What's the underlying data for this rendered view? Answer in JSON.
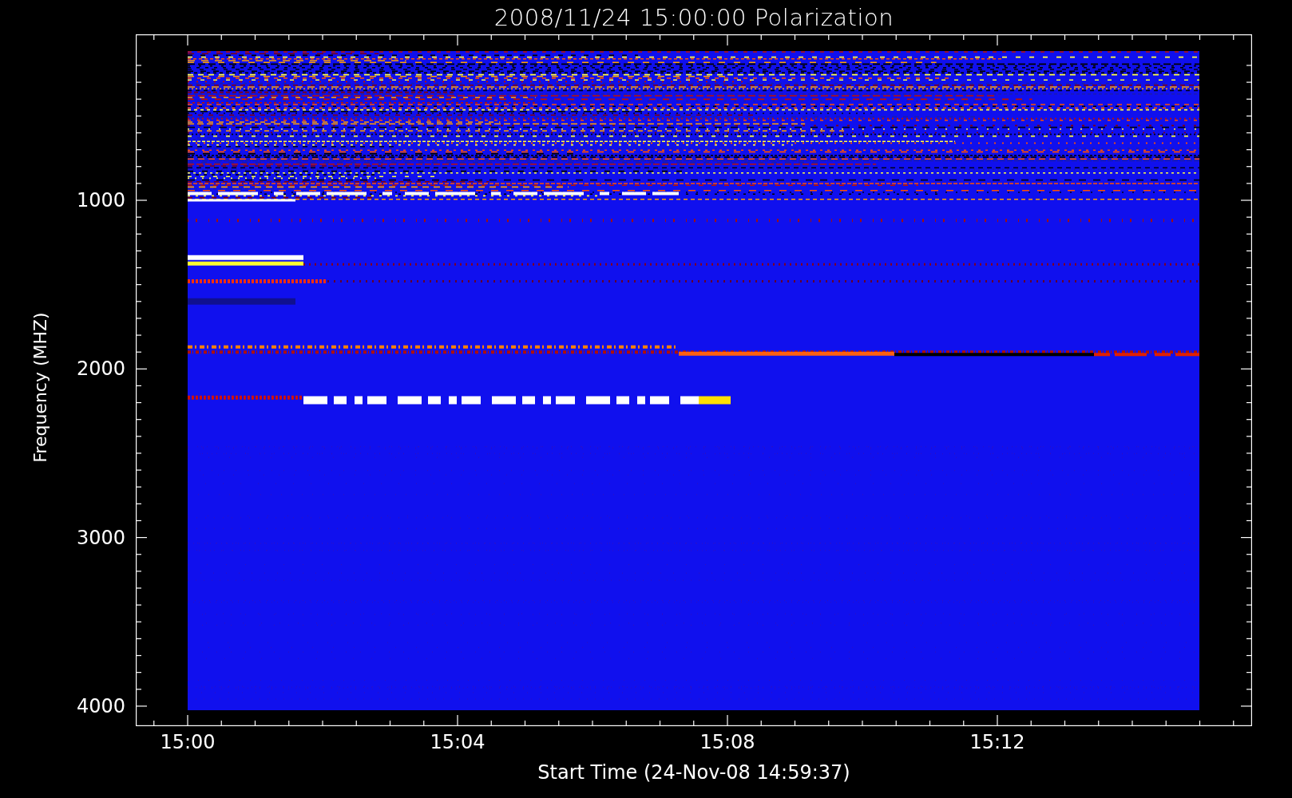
{
  "title": "2008/11/24 15:00:00 Polarization",
  "y_axis": {
    "label": "Frequency (MHZ)",
    "ticks": [
      "1000",
      "2000",
      "3000",
      "4000"
    ]
  },
  "x_axis": {
    "label": "Start Time (24-Nov-08 14:59:37)",
    "ticks": [
      "15:00",
      "15:04",
      "15:08",
      "15:12"
    ]
  }
}
